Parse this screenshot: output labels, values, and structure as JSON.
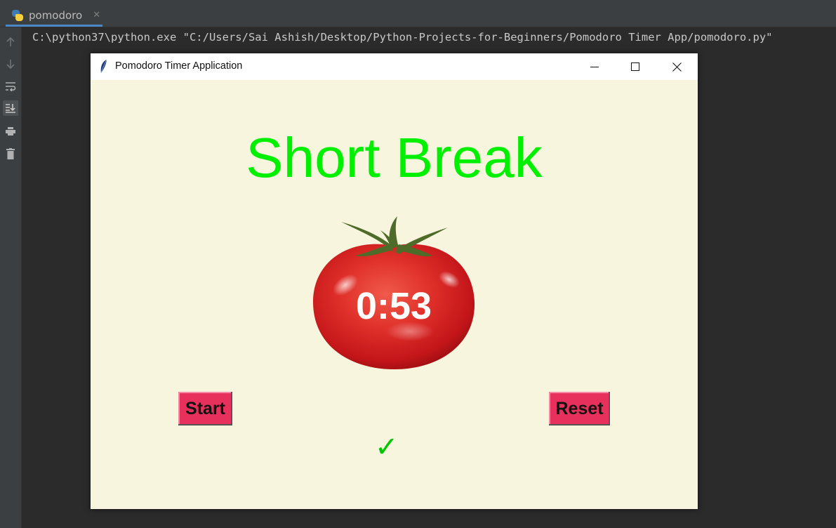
{
  "ide": {
    "tab": {
      "label": "pomodoro",
      "close_glyph": "✕",
      "icon": "python-icon"
    },
    "gutter_icons": [
      "arrow-up-icon",
      "arrow-down-icon",
      "soft-wrap-icon",
      "scroll-to-end-icon",
      "print-icon",
      "trash-icon"
    ],
    "console_line": "C:\\python37\\python.exe \"C:/Users/Sai Ashish/Desktop/Python-Projects-for-Beginners/Pomodoro Timer App/pomodoro.py\""
  },
  "app_window": {
    "title": "Pomodoro Timer Application",
    "controls": [
      "minimize-icon",
      "maximize-icon",
      "close-icon"
    ],
    "heading": "Short Break",
    "timer": "0:53",
    "start_label": "Start",
    "reset_label": "Reset",
    "checkmarks": "✓",
    "colors": {
      "background": "#f7f5dd",
      "heading": "#00f000",
      "button": "#e7305b",
      "check": "#00c800",
      "tomato": "#d81e1e"
    }
  }
}
